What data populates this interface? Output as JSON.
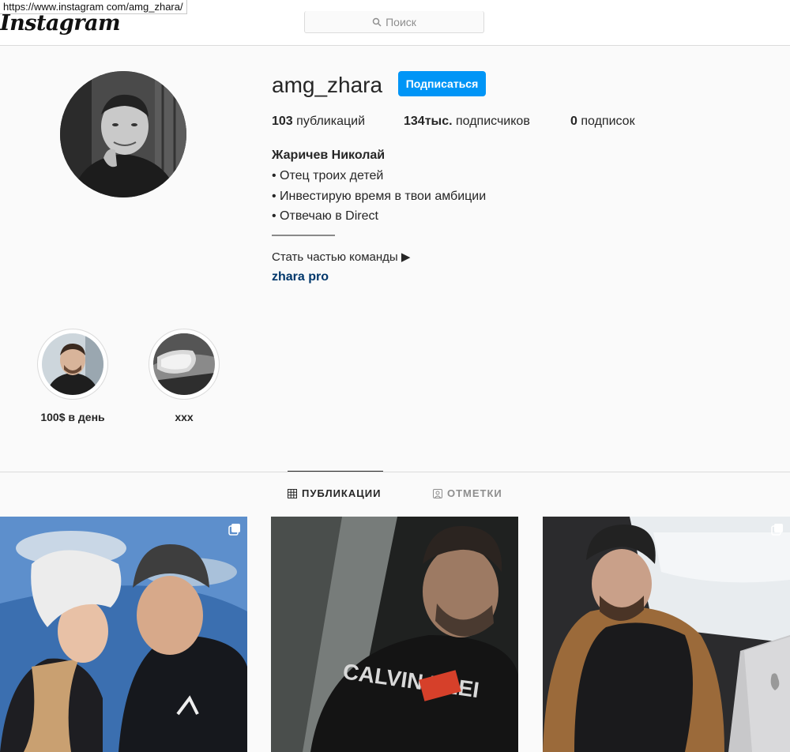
{
  "browser": {
    "url": "https://www.instagram com/amg_zhara/"
  },
  "header": {
    "logo": "Instagram",
    "search_placeholder": "Поиск"
  },
  "profile": {
    "username": "amg_zhara",
    "follow_label": "Подписаться",
    "stats": {
      "posts_count": "103",
      "posts_label": " публикаций",
      "followers_count": "134тыс.",
      "followers_label": " подписчиков",
      "following_count": "0",
      "following_label": " подписок"
    },
    "bio": {
      "name": "Жаричев Николай",
      "line1": "• Отец троих детей",
      "line2": "• Инвестирую время в твои амбиции",
      "line3": "• Отвечаю в Direct",
      "divider": "—————",
      "line4": "Стать частью команды ▶",
      "link": "zhara pro"
    }
  },
  "highlights": [
    {
      "label": "100$ в день"
    },
    {
      "label": "ххх"
    }
  ],
  "tabs": {
    "posts": "ПУБЛИКАЦИИ",
    "tagged": "ОТМЕТКИ"
  },
  "colors": {
    "accent": "#0095f6",
    "link": "#00376b",
    "border": "#dbdbdb"
  }
}
